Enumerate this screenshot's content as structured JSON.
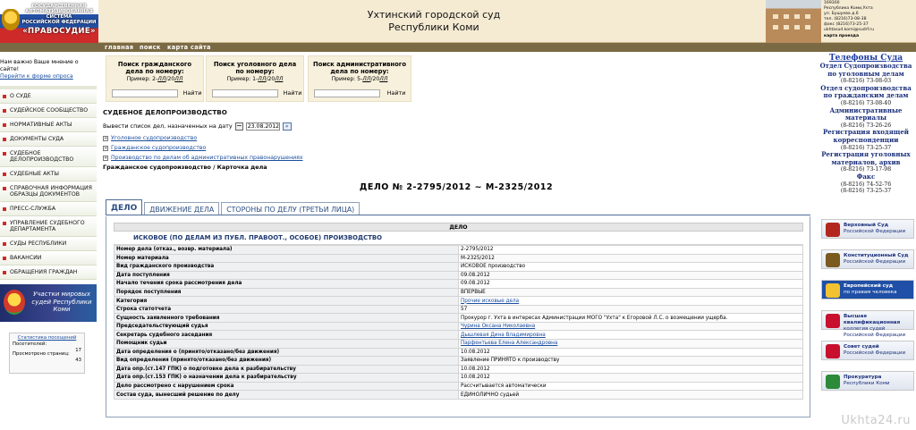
{
  "header": {
    "logo_lines": [
      "ГОСУДАРСТВЕННАЯ",
      "АВТОМАТИЗИРОВАННАЯ СИСТЕМА",
      "РОССИЙСКОЙ ФЕДЕРАЦИИ"
    ],
    "logo_name": "«ПРАВОСУДИЕ»",
    "title_line1": "Ухтинский городской суд",
    "title_line2": "Республики Коми",
    "contact_lines": [
      "169300",
      "Республика Коми,Ухта",
      "ул. Бушуева д.6",
      "тел. (8216)73-08-38",
      "факс (8216)73-25-37",
      "ukhtasud.komi@sudrf.ru"
    ],
    "map_link": "карта проезда"
  },
  "topnav": [
    "главная",
    "поиск",
    "карта сайта"
  ],
  "sidebar": {
    "opinion_text": "Нам важно Ваше мнение о сайте!",
    "opinion_link": "Перейти к форме опроса",
    "menu": [
      "О СУДЕ",
      "СУДЕЙСКОЕ СООБЩЕСТВО",
      "НОРМАТИВНЫЕ АКТЫ",
      "ДОКУМЕНТЫ СУДА",
      "СУДЕБНОЕ ДЕЛОПРОИЗВОДСТВО",
      "СУДЕБНЫЕ АКТЫ",
      "СПРАВОЧНАЯ ИНФОРМАЦИЯ ОБРАЗЦЫ ДОКУМЕНТОВ",
      "ПРЕСС-СЛУЖБА",
      "УПРАВЛЕНИЕ СУДЕБНОГО ДЕПАРТАМЕНТА",
      "СУДЫ РЕСПУБЛИКИ",
      "ВАКАНСИИ",
      "ОБРАЩЕНИЯ ГРАЖДАН"
    ],
    "banner_text": "Участки мировых судей Республики Коми",
    "stats": {
      "title": "Статистика посещений",
      "visitors_label": "Посетителей:",
      "visitors_value": "17",
      "views_label": "Просмотрено страниц:",
      "views_value": "43"
    }
  },
  "search_boxes": [
    {
      "title": "Поиск гражданского дела по номеру:",
      "example_pre": "Пример: 2-",
      "example_it1": "ЛЛ",
      "example_mid": "/20",
      "example_it2": "ЛЛ",
      "button": "Найти"
    },
    {
      "title": "Поиск уголовного дела по номеру:",
      "example_pre": "Пример: 1-",
      "example_it1": "ЛЛ",
      "example_mid": "/20",
      "example_it2": "ЛЛ",
      "button": "Найти"
    },
    {
      "title": "Поиск административного дела по номеру:",
      "example_pre": "Пример: 5-",
      "example_it1": "ЛЛ",
      "example_mid": "/20",
      "example_it2": "ЛЛ",
      "button": "Найти"
    }
  ],
  "main": {
    "section_title": "СУДЕБНОЕ ДЕЛОПРОИЗВОДСТВО",
    "date_label": "Вывести список дел, назначенных на дату",
    "date_value": "23.08.2012",
    "go_symbol": "»",
    "tree": [
      "Уголовное судопроизводство",
      "Гражданское судопроизводство",
      "Производство по делам об административных правонарушениях"
    ],
    "breadcrumb": "Гражданское судопроизводство / Карточка дела",
    "case_title": "ДЕЛО № 2-2795/2012 ~ М-2325/2012",
    "tabs": [
      "ДЕЛО",
      "ДВИЖЕНИЕ ДЕЛА",
      "СТОРОНЫ ПО ДЕЛУ (ТРЕТЬИ ЛИЦА)"
    ],
    "delo_header": "ДЕЛО",
    "proceeding": "ИСКОВОЕ (ПО ДЕЛАМ ИЗ ПУБЛ. ПРАВООТ., ОСОБОЕ) ПРОИЗВОДСТВО",
    "fields": [
      {
        "label": "Номер дела (отказ., возвр. материала)",
        "value": "2-2795/2012"
      },
      {
        "label": "Номер материала",
        "value": "М-2325/2012"
      },
      {
        "label": "Вид гражданского производства",
        "value": "ИСКОВОЕ производство"
      },
      {
        "label": "Дата поступления",
        "value": "09.08.2012"
      },
      {
        "label": "Начало течения срока рассмотрения дела",
        "value": "09.08.2012"
      },
      {
        "label": "Порядок поступления",
        "value": "ВПЕРВЫЕ"
      },
      {
        "label": "Категория",
        "value": "Прочие исковые дела",
        "link": true
      },
      {
        "label": "Строка статотчета",
        "value": "57"
      },
      {
        "label": "Сущность заявленного требования",
        "value": "Прокурор г. Ухта в интересах Администрации МОГО \"Ухта\" к Егоровой Л.С. о возмещении ущерба."
      },
      {
        "label": "Председательствующий судья",
        "value": "Чурина Оксана Николаевна",
        "link": true
      },
      {
        "label": "Секретарь судебного заседания",
        "value": "Дышлевая Дина Владимировна",
        "link": true
      },
      {
        "label": "Помощник судьи",
        "value": "Парфентьева Елена Александровна",
        "link": true
      },
      {
        "label": "Дата определения о (принято/отказано/без движения)",
        "value": "10.08.2012"
      },
      {
        "label": "Вид определения (принято/отказано/без движения)",
        "value": "Заявление ПРИНЯТО к производству"
      },
      {
        "label": "Дата опр.(ст.147 ГПК) о подготовке дела к разбирательству",
        "value": "10.08.2012"
      },
      {
        "label": "Дата опр.(ст.153 ГПК) о назначении дела к разбирательству",
        "value": "10.08.2012"
      },
      {
        "label": "Дело рассмотрено с нарушением срока",
        "value": "Рассчитывается автоматически"
      },
      {
        "label": "Состав суда, вынесший решение по делу",
        "value": "ЕДИНОЛИЧНО судьей"
      }
    ]
  },
  "right": {
    "phones_title": "Телефоны Суда",
    "phones": [
      {
        "dept": "Отдел Судопроизводства по уголовным делам",
        "nums": [
          "(8-8216) 73-08-03"
        ]
      },
      {
        "dept": "Отдел судопроизводства по гражданским делам",
        "nums": [
          "(8-8216) 73-08-40"
        ]
      },
      {
        "dept": "Административные материалы",
        "nums": [
          "(8-8216) 73-26-26"
        ]
      },
      {
        "dept": "Регистрация входящей корреспонденции",
        "nums": [
          "(8-8216) 73-25-37"
        ]
      },
      {
        "dept": "Регистрация уголовных материалов, архив",
        "nums": [
          "(8-8216) 73-17-98"
        ]
      },
      {
        "dept": "Факс",
        "nums": [
          "(8-8216) 74-52-76",
          "(8-8216) 73-25-37"
        ]
      }
    ],
    "banners": [
      {
        "t1": "Верховный Суд",
        "t2": "Российской Федерации",
        "style": "light",
        "icon": "#b3261e"
      },
      {
        "t1": "Конституционный Суд",
        "t2": "Российской Федерации",
        "style": "light",
        "icon": "#7a5a1e"
      },
      {
        "t1": "Европейский суд",
        "t2": "по правам человека",
        "style": "blue",
        "icon": "#f2c230"
      },
      {
        "t1": "Высшая квалификационная",
        "t2": "коллегия судей Российской Федерации",
        "style": "light",
        "icon": "#c8102e"
      },
      {
        "t1": "Совет судей",
        "t2": "Российской Федерации",
        "style": "light",
        "icon": "#c8102e"
      },
      {
        "t1": "Прокуратура",
        "t2": "Республики Коми",
        "style": "light",
        "icon": "#2c8a3a"
      }
    ]
  },
  "watermark": "Ukhta24.ru"
}
